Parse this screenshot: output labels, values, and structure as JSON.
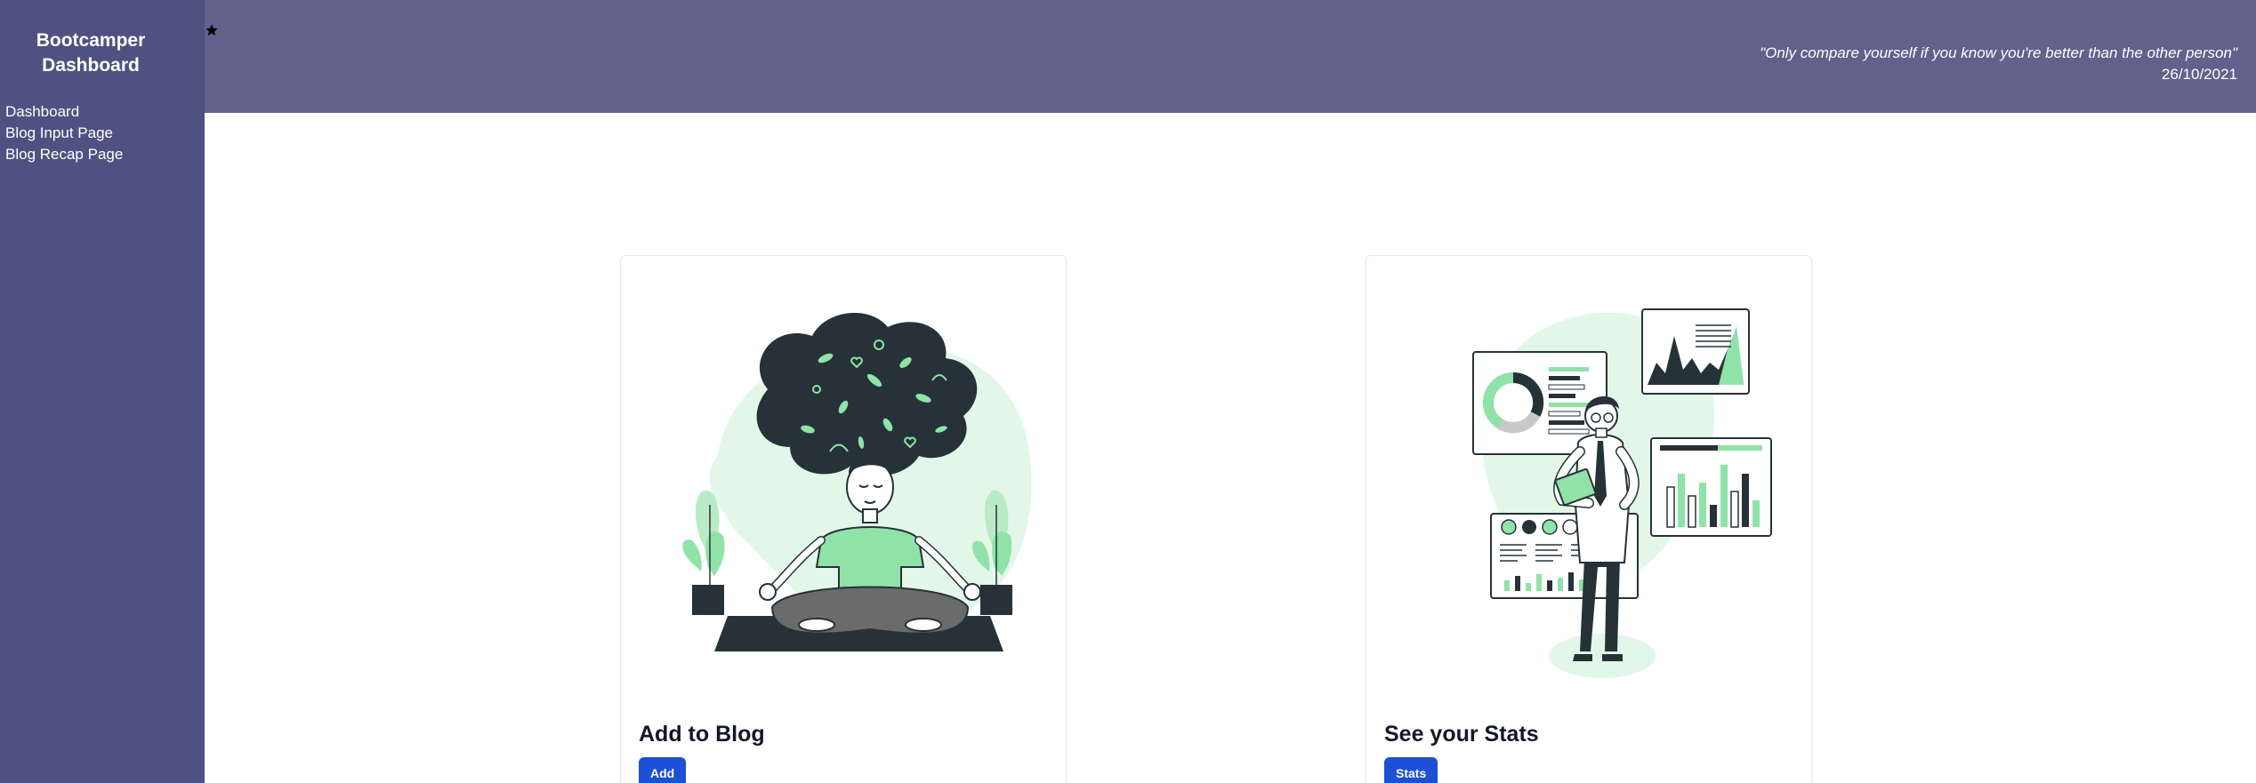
{
  "sidebar": {
    "brand": "Bootcamper Dashboard",
    "items": [
      {
        "label": "Dashboard"
      },
      {
        "label": "Blog Input Page"
      },
      {
        "label": "Blog Recap Page"
      }
    ]
  },
  "header": {
    "icon": "star-icon",
    "quote": "\"Only compare yourself if you know you're better than the other person\"",
    "date": "26/10/2021"
  },
  "cards": [
    {
      "title": "Add to Blog",
      "button": "Add",
      "illustration": "meditating-woman-illustration"
    },
    {
      "title": "See your Stats",
      "button": "Stats",
      "illustration": "analytics-man-illustration"
    }
  ],
  "colors": {
    "sidebar": "#4f5280",
    "header": "#60628c",
    "accent_green": "#8fe3a8",
    "button": "#1d4fd7",
    "illustration_dark": "#263238"
  }
}
